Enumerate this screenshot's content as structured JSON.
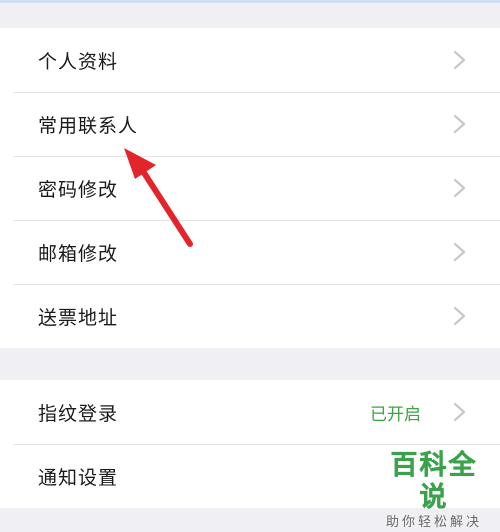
{
  "settings": {
    "group1": [
      {
        "label": "个人资料"
      },
      {
        "label": "常用联系人"
      },
      {
        "label": "密码修改"
      },
      {
        "label": "邮箱修改"
      },
      {
        "label": "送票地址"
      }
    ],
    "group2": [
      {
        "label": "指纹登录",
        "status": "已开启"
      },
      {
        "label": "通知设置"
      }
    ]
  },
  "icons": {
    "row_chevron": "chevron-right-icon",
    "annotation": "red-arrow-icon"
  },
  "colors": {
    "background": "#efeff4",
    "status_on": "#3ea345",
    "annotation_arrow": "#e3242b",
    "watermark": "#3aa24a"
  },
  "watermark": {
    "main": "百科全说",
    "sub": "助你轻松解决"
  }
}
